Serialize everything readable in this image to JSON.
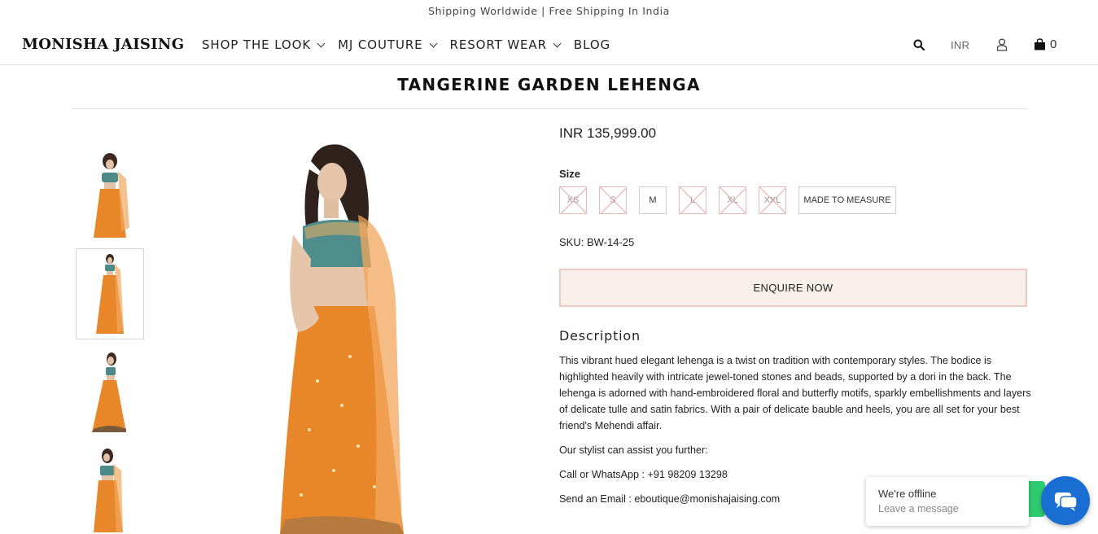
{
  "topbar": {
    "text": "Shipping Worldwide | Free Shipping In India"
  },
  "header": {
    "logo": "MONISHA JAISING",
    "nav": [
      {
        "label": "SHOP THE LOOK",
        "dropdown": true
      },
      {
        "label": "MJ COUTURE",
        "dropdown": true
      },
      {
        "label": "RESORT WEAR",
        "dropdown": true
      },
      {
        "label": "BLOG",
        "dropdown": false
      }
    ],
    "currency": "INR",
    "cart_count": "0"
  },
  "product": {
    "title": "TANGERINE GARDEN LEHENGA",
    "price": "INR 135,999.00",
    "size_label": "Size",
    "sizes": [
      {
        "label": "XS",
        "available": false
      },
      {
        "label": "S",
        "available": false
      },
      {
        "label": "M",
        "available": true
      },
      {
        "label": "L",
        "available": false
      },
      {
        "label": "XL",
        "available": false
      },
      {
        "label": "XXL",
        "available": false
      },
      {
        "label": "MADE TO MEASURE",
        "available": true
      }
    ],
    "sku": "SKU: BW-14-25",
    "enquire_label": "ENQUIRE NOW",
    "description_title": "Description",
    "description": "This vibrant hued elegant lehenga is a twist on tradition with contemporary styles. The bodice is highlighted heavily with intricate jewel-toned stones and beads, supported by a dori in the back. The lehenga is adorned with hand-embroidered floral and butterfly motifs, sparkly embellishments and layers of delicate tulle and satin fabrics. With a pair of delicate bauble and heels, you are all set for your best friend's Mehendi affair.",
    "stylist_line": "Our stylist can assist you further:",
    "phone_line": "Call or WhatsApp : +91 98209 13298",
    "email_line": "Send an Email : eboutique@monishajaising.com"
  },
  "chat": {
    "title": "We're offline",
    "subtitle": "Leave a message",
    "bubble_color": "#1a6ed1",
    "whatsapp_color": "#2ecc71"
  },
  "colors": {
    "lehenga_orange": "#e8862a",
    "enquire_bg": "#f8eeea",
    "enquire_border": "#ecc9c0"
  }
}
